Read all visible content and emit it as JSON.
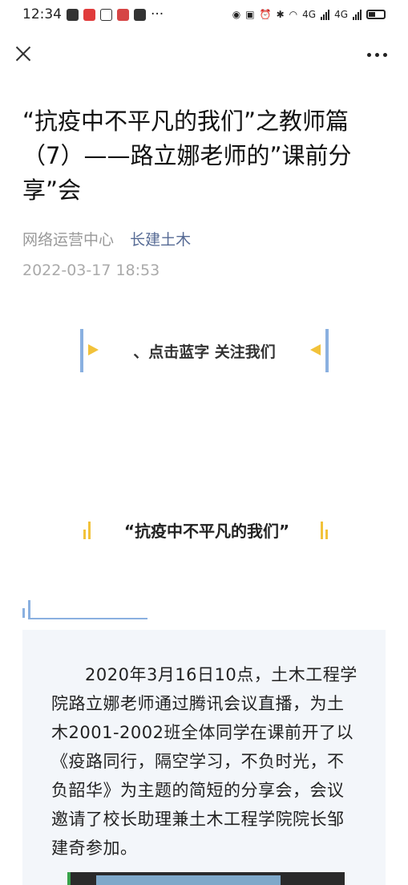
{
  "status_bar": {
    "time": "12:34",
    "left_icons": [
      "chat-bubble-icon",
      "app-icon",
      "alipay-icon",
      "book-icon",
      "wechat-icon"
    ],
    "more_label": "···",
    "network_label_1": "4G",
    "network_label_2": "4G"
  },
  "nav": {
    "close_icon": "close-icon",
    "more_icon": "more-icon"
  },
  "article": {
    "title": "“抗疫中不平凡的我们”之教师篇（7）——路立娜老师的”课前分享”会",
    "author": "网络运营中心",
    "account": "长建土木",
    "date": "2022-03-17 18:53"
  },
  "follow_banner": {
    "text": "、点击蓝字 关注我们"
  },
  "section": {
    "heading": "“抗疫中不平凡的我们”"
  },
  "body": {
    "paragraph": "2020年3月16日10点，土木工程学院路立娜老师通过腾讯会议直播，为土木2001-2002班全体同学在课前开了以《疫路同行，隔空学习，不负时光，不负韶华》为主题的简短的分享会，会议邀请了校长助理兼土木工程学院院长邹建奇参加。"
  },
  "colors": {
    "accent_blue": "#8ab0e0",
    "accent_yellow": "#f2c23a",
    "link": "#576b95",
    "box_bg": "#f3f6fa"
  }
}
